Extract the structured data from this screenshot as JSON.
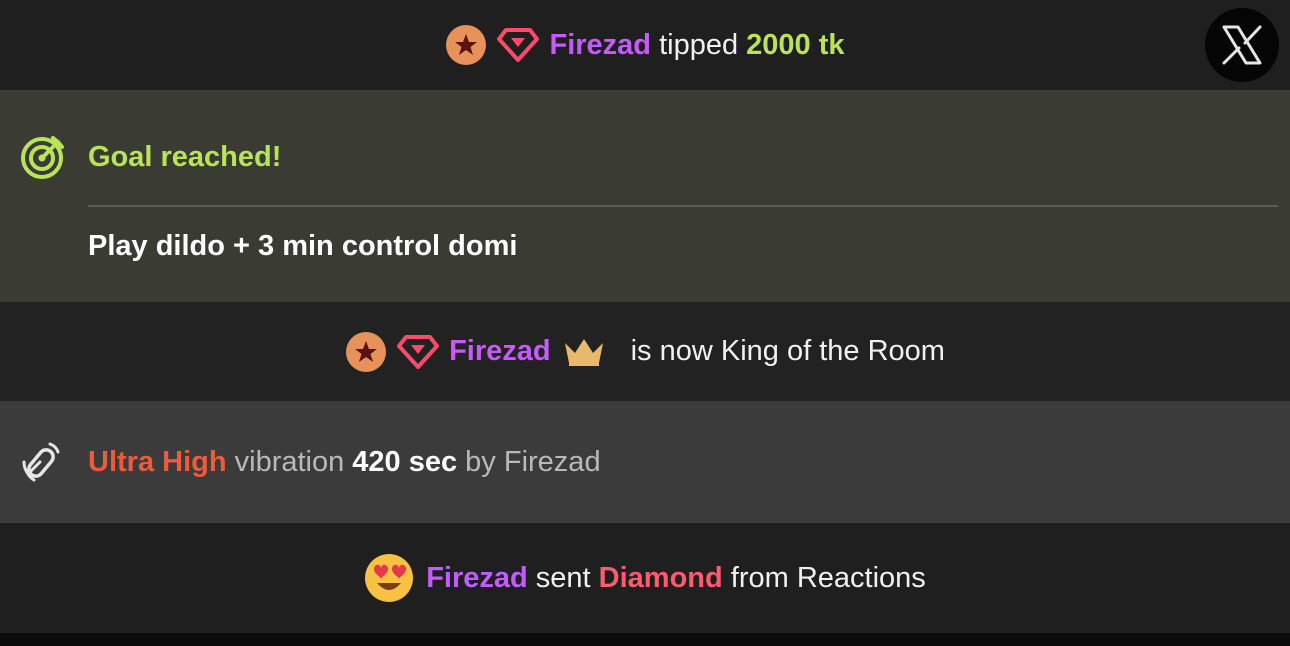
{
  "tip": {
    "username": "Firezad",
    "verb": " tipped ",
    "amount": "2000 tk"
  },
  "close_button": {
    "icon": "x-close-icon"
  },
  "goal": {
    "title": "Goal reached!",
    "description": "Play dildo + 3 min control domi"
  },
  "king": {
    "username": "Firezad",
    "text": "is now King of the Room"
  },
  "vibration": {
    "level": "Ultra High",
    "word": " vibration ",
    "duration": "420 sec",
    "by": " by Firezad"
  },
  "reaction": {
    "username": "Firezad",
    "sent": " sent ",
    "item": "Diamond",
    "from": " from Reactions"
  },
  "colors": {
    "username": "#c45bff",
    "tip_amount": "#b9e35b",
    "goal": "#b9e35b",
    "vibration_level": "#ef5a3b",
    "reaction_item": "#ff5b6e",
    "star_badge": "#e8925b",
    "diamond_badge": "#ff4a6a",
    "crown": "#e8b86b"
  }
}
